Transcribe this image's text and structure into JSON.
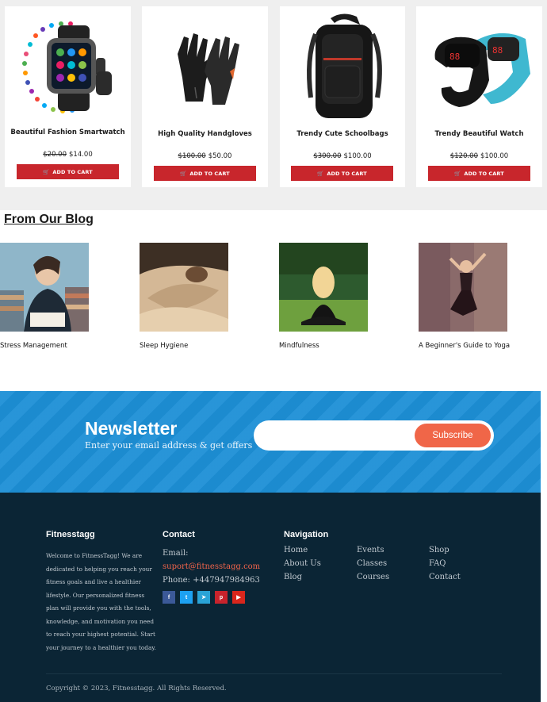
{
  "products": {
    "items": [
      {
        "name": "Beautiful Fashion Smartwatch",
        "old_price": "$20.00",
        "new_price": "$14.00",
        "button": "ADD TO CART"
      },
      {
        "name": "High Quality Handgloves",
        "old_price": "$100.00",
        "new_price": "$50.00",
        "button": "ADD TO CART"
      },
      {
        "name": "Trendy Cute Schoolbags",
        "old_price": "$300.00",
        "new_price": "$100.00",
        "button": "ADD TO CART"
      },
      {
        "name": "Trendy Beautiful Watch",
        "old_price": "$120.00",
        "new_price": "$100.00",
        "button": "ADD TO CART"
      }
    ]
  },
  "blog": {
    "title": "From Our Blog",
    "posts": [
      {
        "title": "Stress Management"
      },
      {
        "title": "Sleep Hygiene"
      },
      {
        "title": "Mindfulness"
      },
      {
        "title": "A Beginner's Guide to Yoga"
      }
    ]
  },
  "newsletter": {
    "title": "Newsletter",
    "subtitle": "Enter your email address & get offers",
    "input_placeholder": "",
    "button": "Subscribe"
  },
  "footer": {
    "about": {
      "heading": "Fitnesstagg",
      "text": "Welcome to FitnessTagg! We are dedicated to helping you reach your fitness goals and live a healthier lifestyle. Our personalized fitness plan will provide you with the tools, knowledge, and motivation you need to reach your highest potential. Start your journey to a healthier you today."
    },
    "contact": {
      "heading": "Contact",
      "email_label": "Email:",
      "email": "suport@fitnesstagg.com",
      "phone": "Phone: +447947984963",
      "socials": [
        {
          "icon": "facebook-icon",
          "glyph": "f",
          "color": "#3b5998"
        },
        {
          "icon": "twitter-icon",
          "glyph": "t",
          "color": "#1da1f2"
        },
        {
          "icon": "telegram-icon",
          "glyph": "➤",
          "color": "#2aa3d6"
        },
        {
          "icon": "pinterest-icon",
          "glyph": "p",
          "color": "#c8232c"
        },
        {
          "icon": "youtube-icon",
          "glyph": "▶",
          "color": "#d9261c"
        }
      ]
    },
    "navigation": {
      "heading": "Navigation",
      "col1": [
        "Home",
        "About Us",
        "Blog"
      ],
      "col2": [
        "Events",
        "Classes",
        "Courses"
      ],
      "col3": [
        "Shop",
        "FAQ",
        "Contact"
      ]
    },
    "copyright": "Copyright © 2023, Fitnesstagg. All Rights Reserved."
  },
  "colors": {
    "accent_red": "#c8262c",
    "newsletter_blue": "#1d8fd6",
    "subscribe_orange": "#f06648",
    "footer_bg": "#0b2535"
  }
}
